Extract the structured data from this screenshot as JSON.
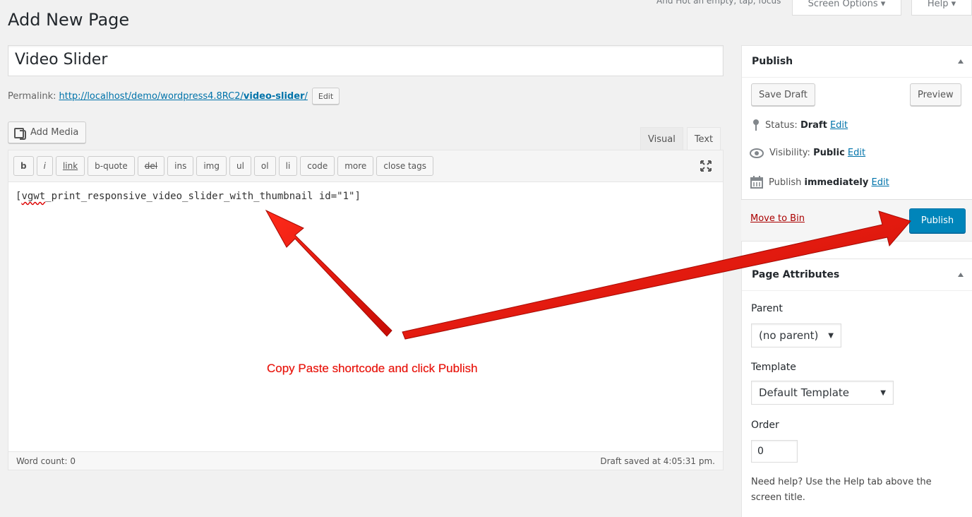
{
  "header": {
    "page_title": "Add New Page",
    "hint_text": "And Hot an empty, tap, focus",
    "screen_options_label": "Screen Options ▾",
    "help_label": "Help ▾"
  },
  "editor": {
    "title_value": "Video Slider",
    "permalink_label": "Permalink:",
    "permalink_base": "http://localhost/demo/wordpress4.8RC2/",
    "permalink_slug": "video-slider",
    "permalink_tail": "/",
    "permalink_edit_label": "Edit",
    "add_media_label": "Add Media",
    "tabs": [
      {
        "label": "Visual",
        "active": false
      },
      {
        "label": "Text",
        "active": true
      }
    ],
    "toolbar_buttons": [
      "b",
      "i",
      "link",
      "b-quote",
      "del",
      "ins",
      "img",
      "ul",
      "ol",
      "li",
      "code",
      "more",
      "close tags"
    ],
    "content_prefix": "[",
    "content_misspelled": "vgwt",
    "content_rest": "_print_responsive_video_slider_with_thumbnail id=\"1\"]",
    "word_count": "Word count: 0",
    "draft_saved": "Draft saved at 4:05:31 pm."
  },
  "annotation": {
    "text": "Copy Paste shortcode and click Publish",
    "color": "#e8170f"
  },
  "publish_box": {
    "title": "Publish",
    "save_draft_label": "Save Draft",
    "preview_label": "Preview",
    "status_label": "Status:",
    "status_value": "Draft",
    "visibility_label": "Visibility:",
    "visibility_value": "Public",
    "publish_label": "Publish",
    "publish_value": "immediately",
    "edit_link": "Edit",
    "move_to_bin_label": "Move to Bin",
    "publish_button_label": "Publish"
  },
  "page_attributes": {
    "title": "Page Attributes",
    "parent_label": "Parent",
    "parent_value": "(no parent)",
    "template_label": "Template",
    "template_value": "Default Template",
    "order_label": "Order",
    "order_value": "0",
    "help_text": "Need help? Use the Help tab above the screen title."
  },
  "colors": {
    "accent": "#0085ba",
    "link": "#0073aa",
    "danger": "#a00",
    "background": "#f1f1f1"
  }
}
